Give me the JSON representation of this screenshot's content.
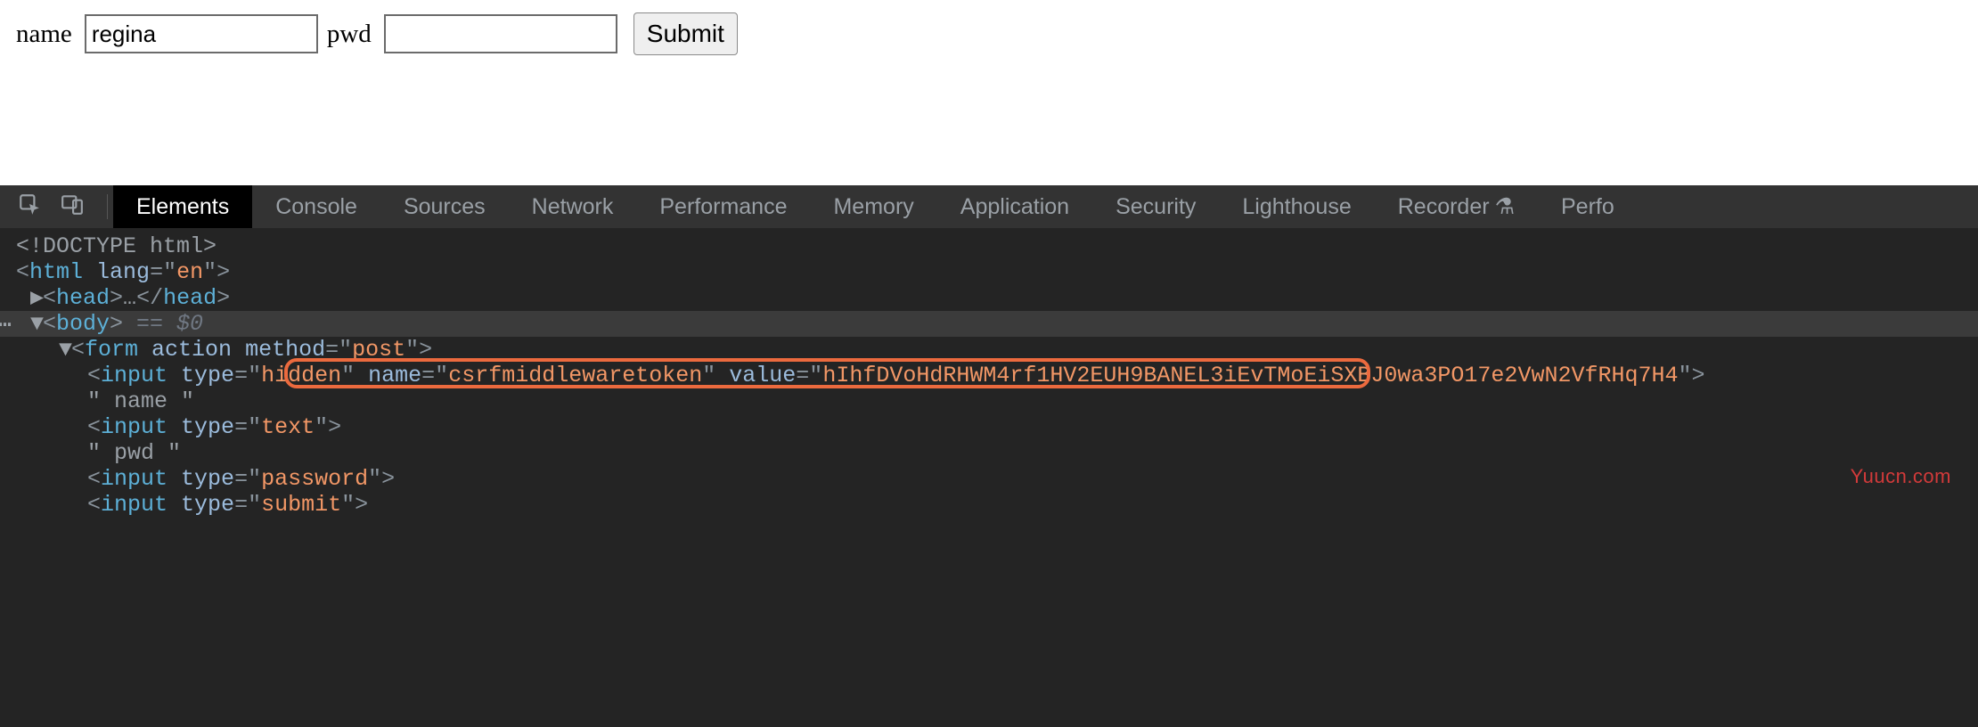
{
  "form": {
    "name_label": "name",
    "name_value": "regina",
    "pwd_label": "pwd",
    "pwd_value": "",
    "submit_label": "Submit"
  },
  "devtools": {
    "tabs": {
      "elements": "Elements",
      "console": "Console",
      "sources": "Sources",
      "network": "Network",
      "performance": "Performance",
      "memory": "Memory",
      "application": "Application",
      "security": "Security",
      "lighthouse": "Lighthouse",
      "recorder": "Recorder",
      "perfo": "Perfo"
    },
    "dom": {
      "doctype": "<!DOCTYPE html>",
      "html_open": {
        "tag": "html",
        "attr": "lang",
        "val": "en"
      },
      "head_collapsed": "head",
      "body_selected": "body",
      "selected_marker": " == $0",
      "form_open": {
        "tag": "form",
        "attr1": "action",
        "attr2": "method",
        "val2": "post"
      },
      "hidden_input": {
        "tag": "input",
        "type": "hidden",
        "name_attr": "name",
        "name_val": "csrfmiddlewaretoken",
        "value_attr": "value",
        "value_val": "hIhfDVoHdRHWM4rf1HV2EUH9BANEL3iEvTMoEiSXBJ0wa3PO17e2VwN2VfRHq7H4"
      },
      "text_name": "\" name \"",
      "text_input": {
        "tag": "input",
        "type": "text"
      },
      "text_pwd": "\" pwd \"",
      "password_input": {
        "tag": "input",
        "type": "password"
      },
      "submit_input": {
        "tag": "input",
        "type": "submit"
      }
    }
  },
  "watermark": "Yuucn.com",
  "flask_glyph": "⚗"
}
